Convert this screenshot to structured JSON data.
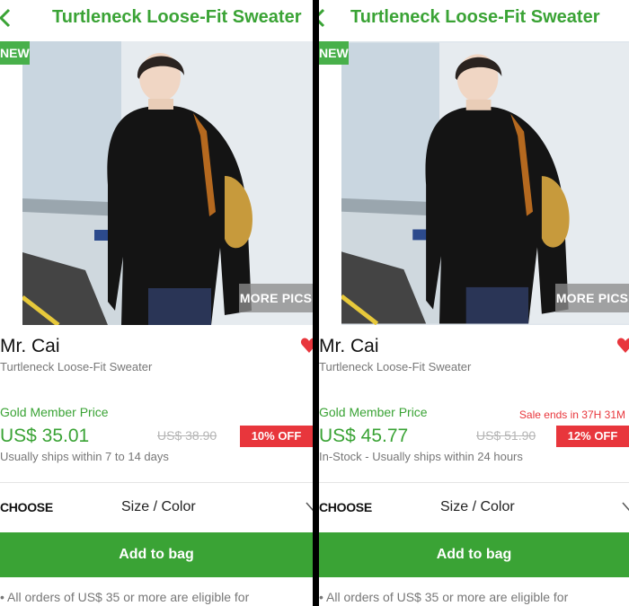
{
  "screens": [
    {
      "title": "Turtleneck Loose-Fit Sweater",
      "new_badge": "NEW",
      "more_pics": "MORE PICS",
      "brand": "Mr. Cai",
      "subtitle": "Turtleneck Loose-Fit Sweater",
      "member_label": "Gold Member Price",
      "sale_ends": "",
      "price": "US$ 35.01",
      "old_price": "US$ 38.90",
      "discount": "10% OFF",
      "shipping": "Usually ships within 7 to 14 days",
      "choose_label": "CHOOSE",
      "option_label": "Size / Color",
      "add_to_bag": "Add to bag",
      "note": "• All orders of US$ 35 or more are eligible for"
    },
    {
      "title": "Turtleneck Loose-Fit Sweater",
      "new_badge": "NEW",
      "more_pics": "MORE PICS",
      "brand": "Mr. Cai",
      "subtitle": "Turtleneck Loose-Fit Sweater",
      "member_label": "Gold Member Price",
      "sale_ends": "Sale ends in 37H 31M",
      "price": "US$ 45.77",
      "old_price": "US$ 51.90",
      "discount": "12% OFF",
      "shipping": "In-Stock - Usually ships within 24 hours",
      "choose_label": "CHOOSE",
      "option_label": "Size / Color",
      "add_to_bag": "Add to bag",
      "note": "• All orders of US$ 35 or more are eligible for"
    }
  ],
  "colors": {
    "brand_green": "#3aa335",
    "sale_red": "#e8363c",
    "heart_red": "#e8363c",
    "muted_gray": "#777777"
  },
  "icons": [
    "back-chevron-icon",
    "heart-icon",
    "chevron-down-icon"
  ]
}
